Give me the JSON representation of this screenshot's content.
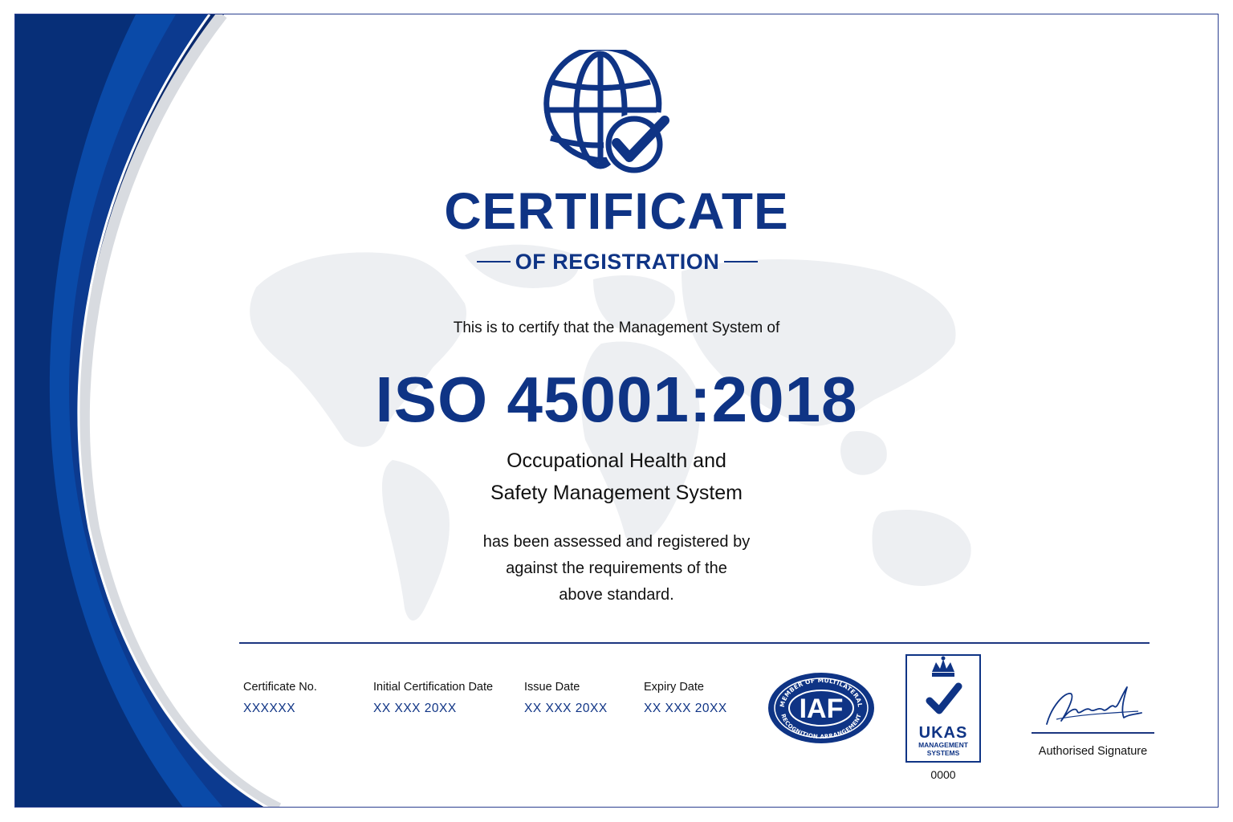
{
  "certificate": {
    "title": "CERTIFICATE",
    "subtitle": "OF REGISTRATION",
    "intro": "This is to certify that the Management System of",
    "standard": "ISO 45001:2018",
    "scope_line1": "Occupational Health and",
    "scope_line2": "Safety Management System",
    "statement_line1": "has been assessed and registered by",
    "statement_line2": "against the requirements of the",
    "statement_line3": "above standard."
  },
  "details": [
    {
      "label": "Certificate No.",
      "value": "XXXXXX"
    },
    {
      "label": "Initial Certification Date",
      "value": "XX XXX 20XX"
    },
    {
      "label": "Issue Date",
      "value": "XX XXX 20XX"
    },
    {
      "label": "Expiry Date",
      "value": "XX XXX 20XX"
    }
  ],
  "accreditation": {
    "iaf_logo_text": "IAF",
    "iaf_ring_top": "MEMBER OF MULTILATERAL",
    "iaf_ring_bottom": "RECOGNITION ARRANGEMENT",
    "ukas_text": "UKAS",
    "ukas_sub1": "MANAGEMENT",
    "ukas_sub2": "SYSTEMS",
    "ukas_number": "0000"
  },
  "signature": {
    "label": "Authorised Signature"
  },
  "icons": {
    "emblem": "globe-check-icon",
    "ukas_crown": "crown-icon",
    "ukas_tick": "checkmark-icon"
  },
  "colors": {
    "primary_navy": "#0f3485",
    "swoosh_blue": "#0a4aa8",
    "swoosh_dark": "#0a2a6e",
    "map_gray": "#eceef1"
  }
}
